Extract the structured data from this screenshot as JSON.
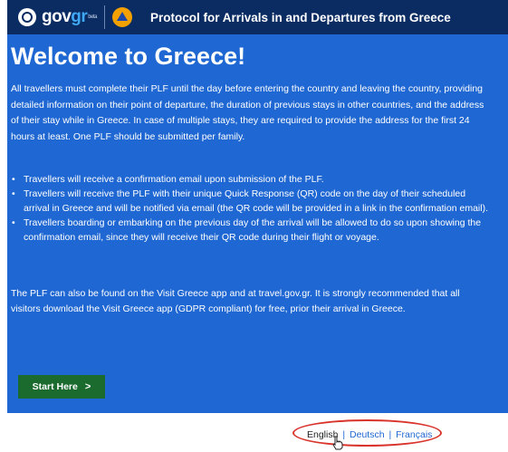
{
  "header": {
    "logo_main": "gov",
    "logo_accent": "gr",
    "logo_badge": "beta",
    "title": "Protocol for Arrivals in and Departures from Greece"
  },
  "main": {
    "heading": "Welcome to Greece!",
    "intro": "All travellers must complete their PLF until the day before entering the country and leaving the country, providing detailed information on their point of departure, the duration of previous stays in other countries, and the address of their stay while in Greece. In case of multiple stays, they are required to provide the address for the first 24 hours at least. One PLF should be submitted per family.",
    "bullets": [
      "Travellers will receive a confirmation email upon submission of the PLF.",
      "Travellers will receive the PLF with their unique Quick Response (QR) code on the day of their scheduled arrival in Greece and will be notified via email (the QR code will be provided in a link in the confirmation email).",
      "Travellers boarding or embarking on the previous day of the arrival will be allowed to do so upon showing the confirmation email, since they will receive their QR code during their flight or voyage."
    ],
    "bullet_mark": "•",
    "outro": "The PLF can also be found on the Visit Greece app and at travel.gov.gr. It is strongly recommended that all visitors download the Visit Greece app (GDPR compliant) for free, prior their arrival in Greece.",
    "start_button": "Start Here",
    "start_chevron": ">"
  },
  "languages": {
    "separator": "|",
    "items": [
      "English",
      "Deutsch",
      "Français"
    ]
  },
  "colors": {
    "header_bg": "#0a2c63",
    "panel_bg": "#1f67d2",
    "button_bg": "#1b6b2e",
    "annotation": "#d9342b"
  }
}
